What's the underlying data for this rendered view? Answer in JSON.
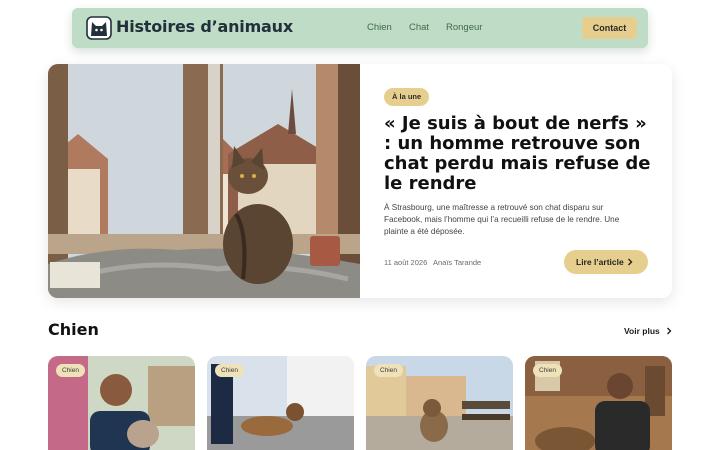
{
  "header": {
    "brand": "Histoires d’animaux",
    "logo_icon": "cat-face-icon",
    "nav": [
      "Chien",
      "Chat",
      "Rongeur"
    ],
    "contact_label": "Contact"
  },
  "hero": {
    "badge": "À la une",
    "title": "« Je suis à bout de nerfs » : un homme retrouve son chat perdu mais refuse de le rendre",
    "description": "À Strasbourg, une maîtresse a retrouvé son chat disparu sur Facebook, mais l’homme qui l’a recueilli refuse de le rendre. Une plainte a été déposée.",
    "date": "11 août 2026",
    "author": "Anaïs Tarande",
    "read_label": "Lire l’article"
  },
  "section": {
    "title": "Chien",
    "see_more": "Voir plus",
    "cards": [
      {
        "tag": "Chien"
      },
      {
        "tag": "Chien"
      },
      {
        "tag": "Chien"
      },
      {
        "tag": "Chien"
      }
    ]
  },
  "colors": {
    "header_bg": "#bfdcc6",
    "accent": "#e6cf8e",
    "nav_text": "#3f6b4c"
  }
}
